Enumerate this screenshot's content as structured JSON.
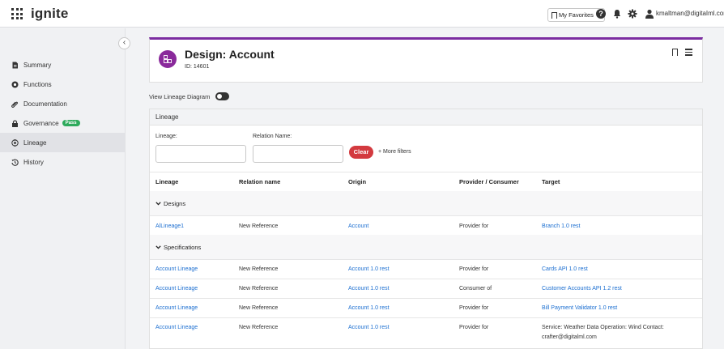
{
  "app": {
    "brand": "ignite"
  },
  "topbar": {
    "favorites_label": "My Favorites",
    "help_glyph": "?",
    "user_email": "kmaltman@digitaIml.com"
  },
  "sidebar": {
    "collapse_glyph": "‹",
    "items": [
      {
        "label": "Summary",
        "icon": "document-icon"
      },
      {
        "label": "Functions",
        "icon": "functions-icon"
      },
      {
        "label": "Documentation",
        "icon": "paperclip-icon"
      },
      {
        "label": "Governance",
        "icon": "lock-icon",
        "badge": "Pass"
      },
      {
        "label": "Lineage",
        "icon": "lineage-icon"
      },
      {
        "label": "History",
        "icon": "history-icon"
      }
    ]
  },
  "header": {
    "title": "Design: Account",
    "id_label": "ID: 14601"
  },
  "toggle": {
    "label": "View Lineage Diagram",
    "on": false
  },
  "lineage": {
    "panel_title": "Lineage",
    "filters": {
      "lineage_label": "Lineage:",
      "relation_label": "Relation Name:",
      "clear_label": "Clear",
      "more_label": "+ More filters"
    },
    "columns": [
      "Lineage",
      "Relation name",
      "Origin",
      "Provider / Consumer",
      "Target"
    ],
    "groups": [
      {
        "label": "Designs",
        "rows": [
          {
            "lineage": "AlLineage1",
            "relation": "New Reference",
            "origin": "Account",
            "role": "Provider for",
            "target": "Branch 1.0 rest"
          }
        ]
      },
      {
        "label": "Specifications",
        "rows": [
          {
            "lineage": "Account Lineage",
            "relation": "New Reference",
            "origin": "Account 1.0 rest",
            "role": "Provider for",
            "target": "Cards API 1.0 rest"
          },
          {
            "lineage": "Account Lineage",
            "relation": "New Reference",
            "origin": "Account 1.0 rest",
            "role": "Consumer of",
            "target": "Customer Accounts API 1.2 rest"
          },
          {
            "lineage": "Account Lineage",
            "relation": "New Reference",
            "origin": "Account 1.0 rest",
            "role": "Provider for",
            "target": "Bill Payment Validator 1.0 rest"
          },
          {
            "lineage": "Account Lineage",
            "relation": "New Reference",
            "origin": "Account 1.0 rest",
            "role": "Provider for",
            "target": "Service: Weather Data Operation: Wind Contact:",
            "target_line2": "crafter@digitalml.com"
          }
        ]
      }
    ]
  },
  "colors": {
    "accent": "#7b2ca0",
    "link": "#1c6fd1",
    "danger": "#d33a3f",
    "pass": "#2eaa5c"
  }
}
